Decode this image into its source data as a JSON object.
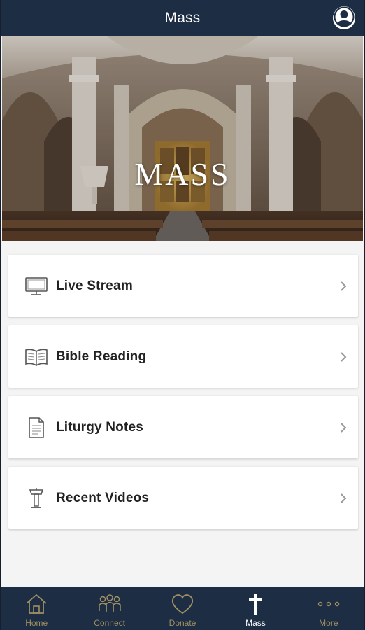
{
  "header": {
    "title": "Mass"
  },
  "hero": {
    "title": "MASS"
  },
  "menu": {
    "items": [
      {
        "label": "Live Stream",
        "icon": "monitor-icon"
      },
      {
        "label": "Bible Reading",
        "icon": "open-book-icon"
      },
      {
        "label": "Liturgy Notes",
        "icon": "document-icon"
      },
      {
        "label": "Recent Videos",
        "icon": "lectern-icon"
      }
    ]
  },
  "tabbar": {
    "active": "Mass",
    "tabs": [
      {
        "label": "Home",
        "icon": "home-icon"
      },
      {
        "label": "Connect",
        "icon": "people-icon"
      },
      {
        "label": "Donate",
        "icon": "heart-icon"
      },
      {
        "label": "Mass",
        "icon": "cross-icon"
      },
      {
        "label": "More",
        "icon": "more-dots-icon"
      }
    ]
  },
  "colors": {
    "nav_bg": "#1d2d44",
    "tab_inactive": "#a08f62",
    "tab_active": "#ffffff",
    "page_bg": "#f4f4f5"
  }
}
